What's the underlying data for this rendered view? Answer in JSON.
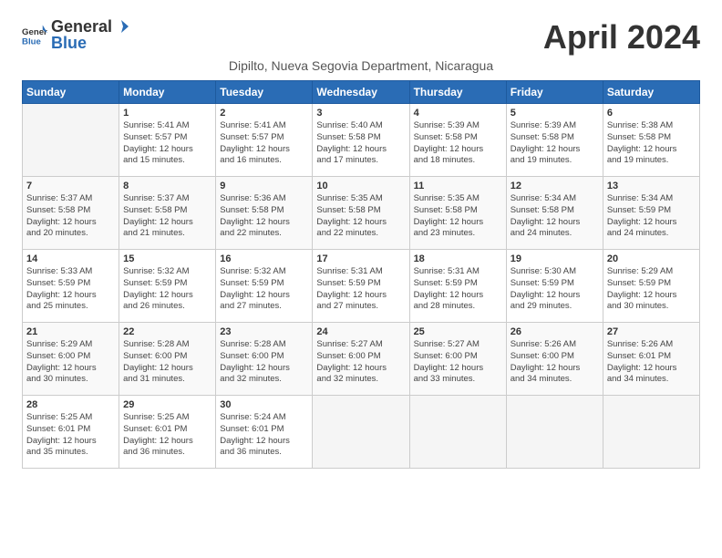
{
  "header": {
    "logo_general": "General",
    "logo_blue": "Blue",
    "month_title": "April 2024",
    "subtitle": "Dipilto, Nueva Segovia Department, Nicaragua"
  },
  "calendar": {
    "days_of_week": [
      "Sunday",
      "Monday",
      "Tuesday",
      "Wednesday",
      "Thursday",
      "Friday",
      "Saturday"
    ],
    "weeks": [
      [
        {
          "day": "",
          "info": ""
        },
        {
          "day": "1",
          "info": "Sunrise: 5:41 AM\nSunset: 5:57 PM\nDaylight: 12 hours\nand 15 minutes."
        },
        {
          "day": "2",
          "info": "Sunrise: 5:41 AM\nSunset: 5:57 PM\nDaylight: 12 hours\nand 16 minutes."
        },
        {
          "day": "3",
          "info": "Sunrise: 5:40 AM\nSunset: 5:58 PM\nDaylight: 12 hours\nand 17 minutes."
        },
        {
          "day": "4",
          "info": "Sunrise: 5:39 AM\nSunset: 5:58 PM\nDaylight: 12 hours\nand 18 minutes."
        },
        {
          "day": "5",
          "info": "Sunrise: 5:39 AM\nSunset: 5:58 PM\nDaylight: 12 hours\nand 19 minutes."
        },
        {
          "day": "6",
          "info": "Sunrise: 5:38 AM\nSunset: 5:58 PM\nDaylight: 12 hours\nand 19 minutes."
        }
      ],
      [
        {
          "day": "7",
          "info": "Sunrise: 5:37 AM\nSunset: 5:58 PM\nDaylight: 12 hours\nand 20 minutes."
        },
        {
          "day": "8",
          "info": "Sunrise: 5:37 AM\nSunset: 5:58 PM\nDaylight: 12 hours\nand 21 minutes."
        },
        {
          "day": "9",
          "info": "Sunrise: 5:36 AM\nSunset: 5:58 PM\nDaylight: 12 hours\nand 22 minutes."
        },
        {
          "day": "10",
          "info": "Sunrise: 5:35 AM\nSunset: 5:58 PM\nDaylight: 12 hours\nand 22 minutes."
        },
        {
          "day": "11",
          "info": "Sunrise: 5:35 AM\nSunset: 5:58 PM\nDaylight: 12 hours\nand 23 minutes."
        },
        {
          "day": "12",
          "info": "Sunrise: 5:34 AM\nSunset: 5:58 PM\nDaylight: 12 hours\nand 24 minutes."
        },
        {
          "day": "13",
          "info": "Sunrise: 5:34 AM\nSunset: 5:59 PM\nDaylight: 12 hours\nand 24 minutes."
        }
      ],
      [
        {
          "day": "14",
          "info": "Sunrise: 5:33 AM\nSunset: 5:59 PM\nDaylight: 12 hours\nand 25 minutes."
        },
        {
          "day": "15",
          "info": "Sunrise: 5:32 AM\nSunset: 5:59 PM\nDaylight: 12 hours\nand 26 minutes."
        },
        {
          "day": "16",
          "info": "Sunrise: 5:32 AM\nSunset: 5:59 PM\nDaylight: 12 hours\nand 27 minutes."
        },
        {
          "day": "17",
          "info": "Sunrise: 5:31 AM\nSunset: 5:59 PM\nDaylight: 12 hours\nand 27 minutes."
        },
        {
          "day": "18",
          "info": "Sunrise: 5:31 AM\nSunset: 5:59 PM\nDaylight: 12 hours\nand 28 minutes."
        },
        {
          "day": "19",
          "info": "Sunrise: 5:30 AM\nSunset: 5:59 PM\nDaylight: 12 hours\nand 29 minutes."
        },
        {
          "day": "20",
          "info": "Sunrise: 5:29 AM\nSunset: 5:59 PM\nDaylight: 12 hours\nand 30 minutes."
        }
      ],
      [
        {
          "day": "21",
          "info": "Sunrise: 5:29 AM\nSunset: 6:00 PM\nDaylight: 12 hours\nand 30 minutes."
        },
        {
          "day": "22",
          "info": "Sunrise: 5:28 AM\nSunset: 6:00 PM\nDaylight: 12 hours\nand 31 minutes."
        },
        {
          "day": "23",
          "info": "Sunrise: 5:28 AM\nSunset: 6:00 PM\nDaylight: 12 hours\nand 32 minutes."
        },
        {
          "day": "24",
          "info": "Sunrise: 5:27 AM\nSunset: 6:00 PM\nDaylight: 12 hours\nand 32 minutes."
        },
        {
          "day": "25",
          "info": "Sunrise: 5:27 AM\nSunset: 6:00 PM\nDaylight: 12 hours\nand 33 minutes."
        },
        {
          "day": "26",
          "info": "Sunrise: 5:26 AM\nSunset: 6:00 PM\nDaylight: 12 hours\nand 34 minutes."
        },
        {
          "day": "27",
          "info": "Sunrise: 5:26 AM\nSunset: 6:01 PM\nDaylight: 12 hours\nand 34 minutes."
        }
      ],
      [
        {
          "day": "28",
          "info": "Sunrise: 5:25 AM\nSunset: 6:01 PM\nDaylight: 12 hours\nand 35 minutes."
        },
        {
          "day": "29",
          "info": "Sunrise: 5:25 AM\nSunset: 6:01 PM\nDaylight: 12 hours\nand 36 minutes."
        },
        {
          "day": "30",
          "info": "Sunrise: 5:24 AM\nSunset: 6:01 PM\nDaylight: 12 hours\nand 36 minutes."
        },
        {
          "day": "",
          "info": ""
        },
        {
          "day": "",
          "info": ""
        },
        {
          "day": "",
          "info": ""
        },
        {
          "day": "",
          "info": ""
        }
      ]
    ]
  }
}
